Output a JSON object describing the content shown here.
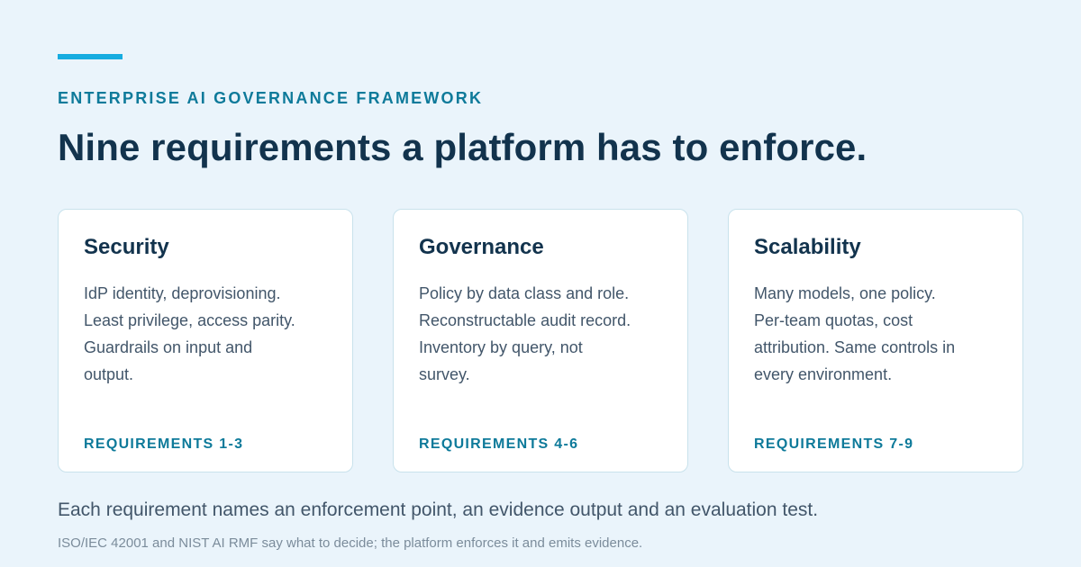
{
  "colors": {
    "background": "#eaf4fb",
    "accent": "#16ace0",
    "eyebrow": "#0e7a9a",
    "headline": "#12334d",
    "body_text": "#42566a",
    "muted_text": "#7b8c9b",
    "card_background": "#ffffff",
    "card_border": "#c9e2ec"
  },
  "header": {
    "eyebrow": "ENTERPRISE AI GOVERNANCE FRAMEWORK",
    "title": "Nine requirements a platform has to enforce."
  },
  "cards": [
    {
      "title": "Security",
      "body": "IdP identity, deprovisioning. Least privilege, access parity. Guardrails on input and output.",
      "link": "REQUIREMENTS 1-3"
    },
    {
      "title": "Governance",
      "body": "Policy by data class and role. Reconstructable audit record. Inventory by query, not survey.",
      "link": "REQUIREMENTS 4-6"
    },
    {
      "title": "Scalability",
      "body": "Many models, one policy. Per-team quotas, cost attribution. Same controls in every environment.",
      "link": "REQUIREMENTS 7-9"
    }
  ],
  "footer": {
    "summary": "Each requirement names an enforcement point, an evidence output and an evaluation test.",
    "note": "ISO/IEC 42001 and NIST AI RMF say what to decide; the platform enforces it and emits evidence."
  }
}
